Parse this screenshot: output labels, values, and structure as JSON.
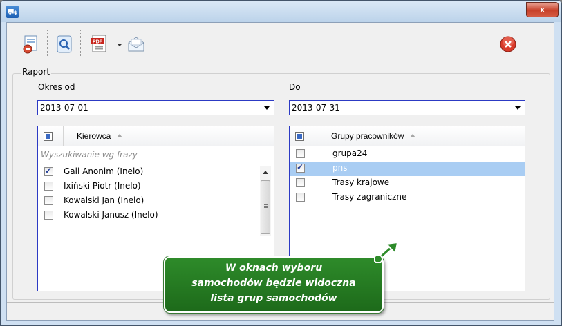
{
  "window": {
    "title": "",
    "close_glyph": "x"
  },
  "toolbar": {
    "icons": [
      "report-icon",
      "search-icon",
      "pdf-icon",
      "dropdown-arrow-icon",
      "email-icon",
      "close-report-icon"
    ],
    "pdf_label": "PDF"
  },
  "report": {
    "group_title": "Raport",
    "from_label": "Okres od",
    "to_label": "Do",
    "from_value": "2013-07-01",
    "to_value": "2013-07-31"
  },
  "drivers_grid": {
    "header": "Kierowca",
    "filter_placeholder": "Wyszukiwanie wg frazy",
    "rows": [
      {
        "label": "Gall Anonim (Inelo)",
        "checked": true
      },
      {
        "label": "Ixiński Piotr (Inelo)",
        "checked": false
      },
      {
        "label": "Kowalski Jan (Inelo)",
        "checked": false
      },
      {
        "label": "Kowalski Janusz (Inelo)",
        "checked": false
      }
    ]
  },
  "groups_grid": {
    "header": "Grupy pracowników",
    "rows": [
      {
        "label": "grupa24",
        "checked": false,
        "selected": false
      },
      {
        "label": "pns",
        "checked": true,
        "selected": true
      },
      {
        "label": "Trasy krajowe",
        "checked": false,
        "selected": false
      },
      {
        "label": "Trasy zagraniczne",
        "checked": false,
        "selected": false
      }
    ]
  },
  "tooltip": {
    "line1": "W oknach wyboru",
    "line2": "samochodów będzie widoczna",
    "line3": "lista grup samochodów"
  },
  "colors": {
    "accent_border": "#2c3ac4",
    "selection": "#a9cdf3",
    "tooltip_green": "#2e8b2a",
    "close_red": "#c7412a"
  }
}
